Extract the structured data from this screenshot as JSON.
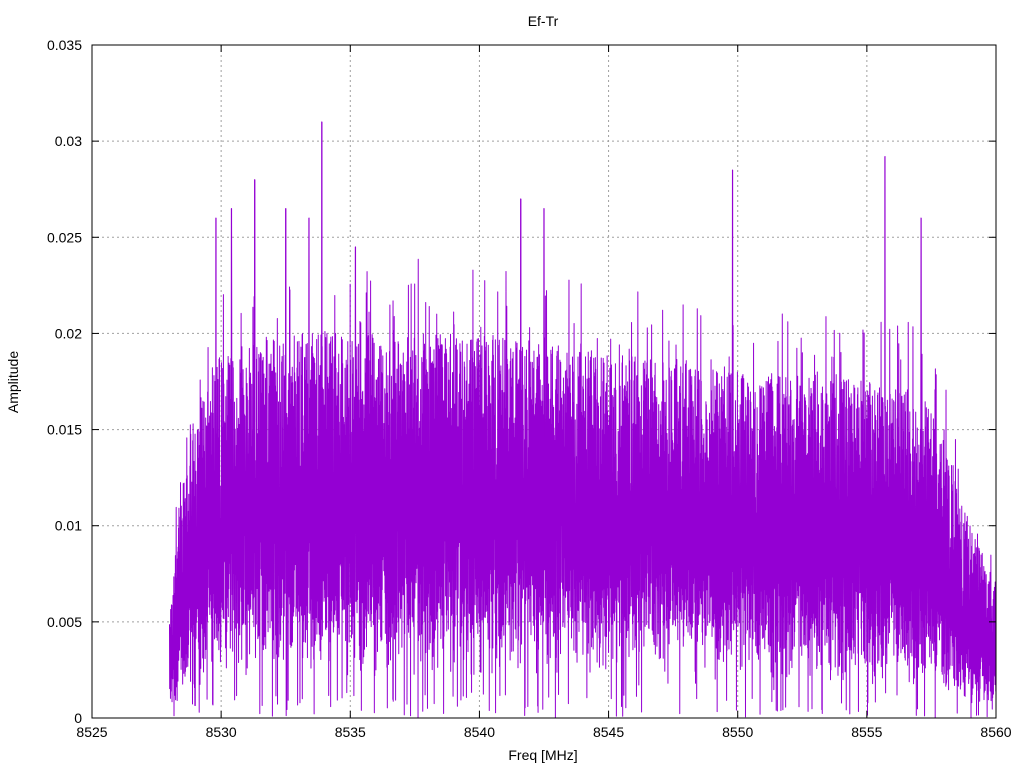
{
  "chart_data": {
    "type": "line",
    "title": "Ef-Tr",
    "xlabel": "Freq [MHz]",
    "ylabel": "Amplitude",
    "xlim": [
      8525,
      8560
    ],
    "ylim": [
      0,
      0.035
    ],
    "x_ticks": [
      "8525",
      "8530",
      "8535",
      "8540",
      "8545",
      "8550",
      "8555",
      "8560"
    ],
    "y_ticks": [
      "0",
      "0.005",
      "0.01",
      "0.015",
      "0.02",
      "0.025",
      "0.03",
      "0.035"
    ],
    "grid": true,
    "legend": "none",
    "series": [
      {
        "color": "#9400D3",
        "x_start": 8528.0,
        "x_end": 8560.0,
        "envelope_x": [
          8528.0,
          8528.5,
          8529.0,
          8530.0,
          8532.0,
          8535.0,
          8540.0,
          8545.0,
          8550.0,
          8555.0,
          8557.0,
          8558.0,
          8559.0,
          8560.0
        ],
        "envelope_low": [
          0.0005,
          0.002,
          0.003,
          0.004,
          0.004,
          0.0045,
          0.0045,
          0.004,
          0.0035,
          0.003,
          0.0025,
          0.0015,
          0.001,
          0.0005
        ],
        "envelope_high": [
          0.006,
          0.012,
          0.016,
          0.019,
          0.02,
          0.02,
          0.02,
          0.019,
          0.018,
          0.0175,
          0.017,
          0.015,
          0.01,
          0.007
        ],
        "peaks": [
          {
            "x": 8529.8,
            "y": 0.026
          },
          {
            "x": 8530.4,
            "y": 0.0265
          },
          {
            "x": 8531.3,
            "y": 0.028
          },
          {
            "x": 8532.5,
            "y": 0.0265
          },
          {
            "x": 8533.4,
            "y": 0.026
          },
          {
            "x": 8533.9,
            "y": 0.031
          },
          {
            "x": 8535.2,
            "y": 0.0245
          },
          {
            "x": 8541.6,
            "y": 0.027
          },
          {
            "x": 8542.5,
            "y": 0.0265
          },
          {
            "x": 8549.8,
            "y": 0.0285
          },
          {
            "x": 8555.7,
            "y": 0.0292
          },
          {
            "x": 8557.1,
            "y": 0.026
          }
        ]
      }
    ]
  }
}
